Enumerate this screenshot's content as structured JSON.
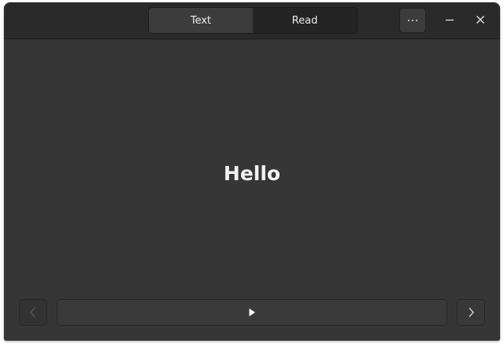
{
  "header": {
    "tabs": [
      {
        "label": "Text",
        "active": true
      },
      {
        "label": "Read",
        "active": false
      }
    ],
    "menu_icon": "more-horizontal-icon",
    "minimize_icon": "minimize-icon",
    "close_icon": "close-icon"
  },
  "main": {
    "display_text": "Hello"
  },
  "footer": {
    "prev_icon": "chevron-left-icon",
    "play_icon": "play-icon",
    "next_icon": "chevron-right-icon"
  },
  "colors": {
    "window_bg": "#363636",
    "header_bg": "#2a2a2a",
    "active_tab_bg": "#3c3c3c",
    "inactive_tab_bg": "#242424",
    "text": "#f2f2f2"
  }
}
